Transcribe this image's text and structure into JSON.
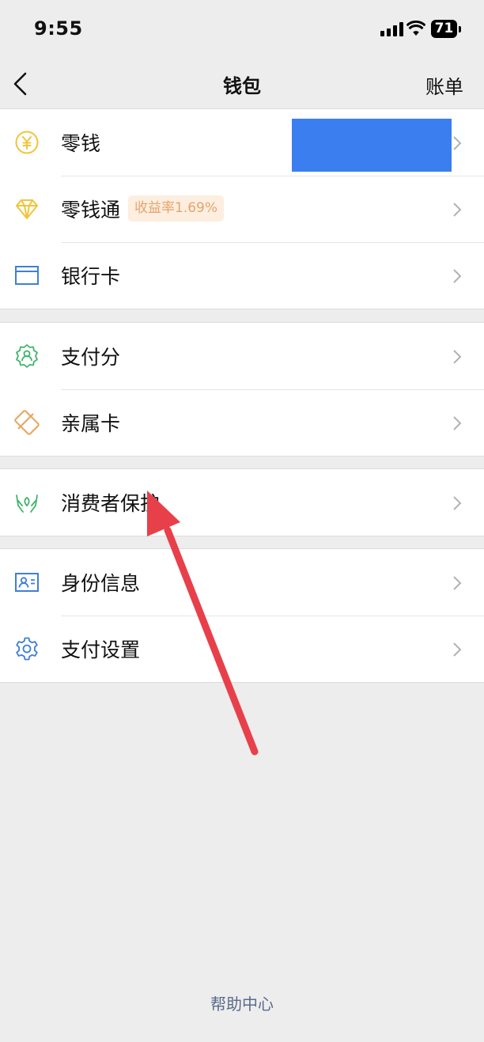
{
  "status_bar": {
    "time": "9:55",
    "battery": "71"
  },
  "nav": {
    "title": "钱包",
    "right_label": "账单"
  },
  "groups": [
    {
      "items": [
        {
          "label": "零钱"
        },
        {
          "label": "零钱通",
          "badge": "收益率1.69%"
        },
        {
          "label": "银行卡"
        }
      ]
    },
    {
      "items": [
        {
          "label": "支付分"
        },
        {
          "label": "亲属卡"
        }
      ]
    },
    {
      "items": [
        {
          "label": "消费者保护"
        }
      ]
    },
    {
      "items": [
        {
          "label": "身份信息"
        },
        {
          "label": "支付设置"
        }
      ]
    }
  ],
  "footer": {
    "help_label": "帮助中心"
  },
  "colors": {
    "background": "#ededed",
    "redaction": "#3b7ef0",
    "arrow": "#e8404a",
    "badge_text": "#e5a46c",
    "link": "#5b6b8c"
  }
}
